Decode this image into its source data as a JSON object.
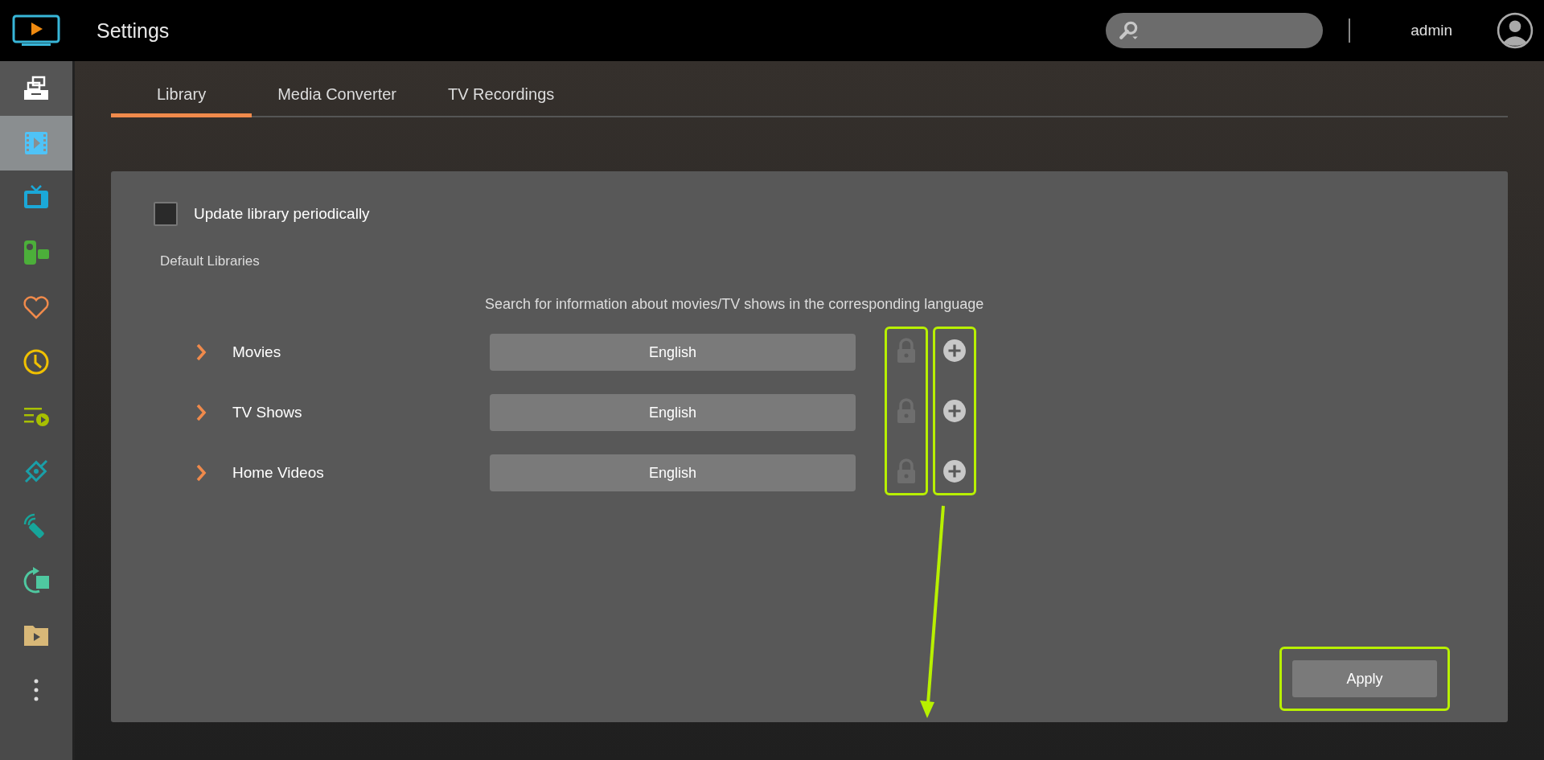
{
  "window": {
    "title": "Settings"
  },
  "header": {
    "user": "admin"
  },
  "sidebar": {
    "items": [
      {
        "kind": "server",
        "selected": false
      },
      {
        "kind": "film",
        "selected": true
      },
      {
        "kind": "tv",
        "selected": false
      },
      {
        "kind": "camera",
        "selected": false
      },
      {
        "kind": "heart",
        "selected": false
      },
      {
        "kind": "clock",
        "selected": false
      },
      {
        "kind": "playlist",
        "selected": false
      },
      {
        "kind": "link",
        "selected": false
      },
      {
        "kind": "remote",
        "selected": false
      },
      {
        "kind": "refresh",
        "selected": false
      },
      {
        "kind": "folder",
        "selected": false
      },
      {
        "kind": "more",
        "selected": false
      }
    ]
  },
  "tabs": [
    {
      "label": "Library",
      "selected": true
    },
    {
      "label": "Media Converter",
      "selected": false
    },
    {
      "label": "TV Recordings",
      "selected": false
    }
  ],
  "panel": {
    "update_periodically": {
      "label": "Update library periodically",
      "checked": false
    },
    "section_title": "Default Libraries",
    "hint": "Search for information about movies/TV shows in the corresponding language",
    "libraries": [
      {
        "name": "Movies",
        "language": "English"
      },
      {
        "name": "TV Shows",
        "language": "English"
      },
      {
        "name": "Home Videos",
        "language": "English"
      }
    ],
    "apply": "Apply"
  }
}
